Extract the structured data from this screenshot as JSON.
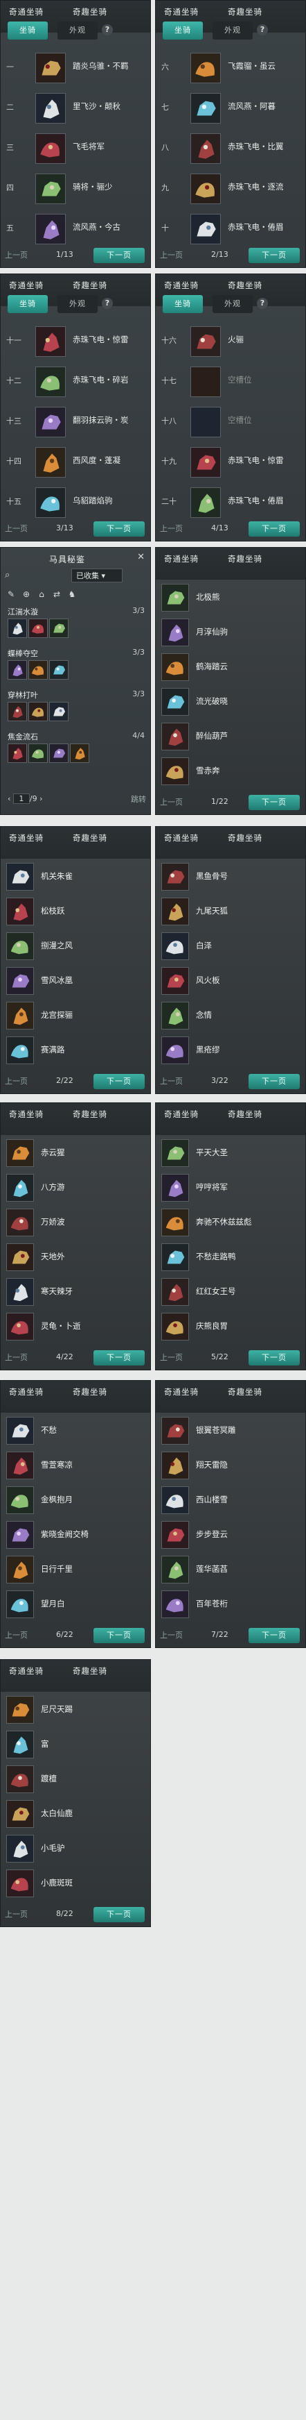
{
  "tabs": {
    "normal": "奇通坐骑",
    "special": "奇趣坐骑"
  },
  "segments": {
    "mount": "坐骑",
    "look": "外观"
  },
  "help": "?",
  "pager": {
    "prev": "上一页",
    "next": "下一页"
  },
  "panels": [
    {
      "page": "1/13",
      "rows": [
        {
          "num": "一",
          "name": "踏炎乌骓・不羁"
        },
        {
          "num": "二",
          "name": "里飞沙・颠秋"
        },
        {
          "num": "三",
          "name": "飞毛将军"
        },
        {
          "num": "四",
          "name": "骑将・骊少"
        },
        {
          "num": "五",
          "name": "流风燕・今古"
        }
      ]
    },
    {
      "page": "2/13",
      "rows": [
        {
          "num": "六",
          "name": "飞霞骝・虽云"
        },
        {
          "num": "七",
          "name": "流风燕・阿暮"
        },
        {
          "num": "八",
          "name": "赤珠飞电・比翼"
        },
        {
          "num": "九",
          "name": "赤珠飞电・逐流"
        },
        {
          "num": "十",
          "name": "赤珠飞电・倦眉"
        }
      ]
    },
    {
      "page": "3/13",
      "rows": [
        {
          "num": "十一",
          "name": "赤珠飞电・惊雷"
        },
        {
          "num": "十二",
          "name": "赤珠飞电・碎岩"
        },
        {
          "num": "十三",
          "name": "翻羽抹云驹・炭"
        },
        {
          "num": "十四",
          "name": "西风度・蓬凝"
        },
        {
          "num": "十五",
          "name": "乌貂踏焰驹"
        }
      ]
    },
    {
      "page": "4/13",
      "rows": [
        {
          "num": "十六",
          "name": "火骊"
        },
        {
          "num": "十七",
          "name": "空槽位"
        },
        {
          "num": "十八",
          "name": "空槽位"
        },
        {
          "num": "十九",
          "name": "赤珠飞电・惊雷"
        },
        {
          "num": "二十",
          "name": "赤珠飞电・倦眉"
        }
      ]
    }
  ],
  "equip": {
    "title": "马具秘鉴",
    "close": "✕",
    "filter": "已收集",
    "groups": [
      {
        "name": "江湍水漩",
        "count": "3/3"
      },
      {
        "name": "蝶棒夺空",
        "count": "3/3"
      },
      {
        "name": "穿林打叶",
        "count": "3/3"
      },
      {
        "name": "焦金流石",
        "count": "4/4"
      }
    ],
    "page_cur": "1",
    "page_total": "/9",
    "jump": "跳转"
  },
  "lists": [
    {
      "page": "1/22",
      "items": [
        "北极熊",
        "月淳仙驹",
        "鹤海踏云",
        "流光破晓",
        "醉仙葫芦",
        "雪赤奔"
      ]
    },
    {
      "page": "2/22",
      "items": [
        "机关朱雀",
        "松枝跃",
        "捌漫之风",
        "雪风冰凰",
        "龙宫探骊",
        "赛满路"
      ]
    },
    {
      "page": "3/22",
      "items": [
        "黑鱼骨号",
        "九尾天狐",
        "白泽",
        "风火板",
        "念情",
        "黑疮缪"
      ]
    },
    {
      "page": "4/22",
      "items": [
        "赤云猩",
        "八方游",
        "万娇波",
        "天地外",
        "寒天辣牙",
        "灵龟・卜逝"
      ]
    },
    {
      "page": "5/22",
      "items": [
        "平天大圣",
        "哼哼将军",
        "奔驰不休兹兹彪",
        "不愁走路鸭",
        "红红女王号",
        "庆熊良胃"
      ]
    },
    {
      "page": "6/22",
      "items": [
        "不愁",
        "雪萱寒凉",
        "金枫抱月",
        "紫晓金阙交椅",
        "日行千里",
        "望月白"
      ]
    },
    {
      "page": "7/22",
      "items": [
        "银翼苍冥雕",
        "翔天雷隐",
        "西山楼雪",
        "步步登云",
        "莲华菡萏",
        "百年苍桁"
      ]
    },
    {
      "page": "8/22",
      "items": [
        "尼尺天踢",
        "富",
        "踱檀",
        "太白仙鹿",
        "小毛驴",
        "小鹿斑斑"
      ]
    }
  ]
}
